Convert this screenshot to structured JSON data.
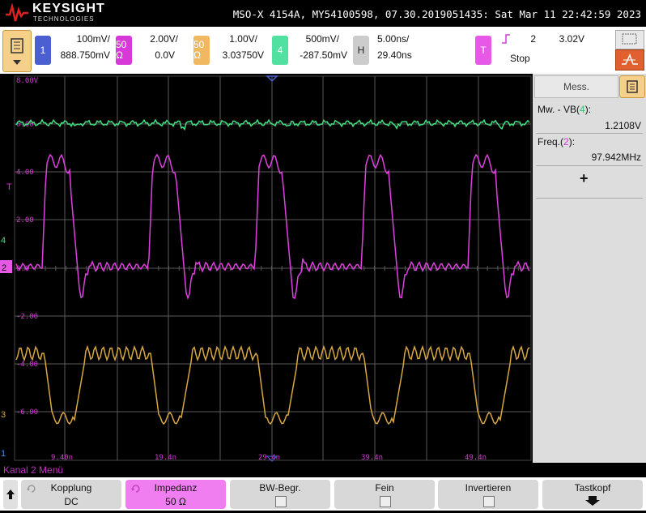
{
  "header": {
    "brand": "KEYSIGHT",
    "brand_sub": "TECHNOLOGIES",
    "info": "MSO-X 4154A, MY54100598, 07.30.2019051435: Sat Mar 11 22:42:59 2023"
  },
  "channels": [
    {
      "id": "1",
      "color": "#4a5fd0",
      "scale": "100mV/",
      "offset": "888.750mV"
    },
    {
      "id": "50 Ω",
      "color": "#d838d8",
      "scale": "2.00V/",
      "offset": "0.0V"
    },
    {
      "id": "50 Ω",
      "color": "#e0a040",
      "scale": "1.00V/",
      "offset": "3.03750V"
    },
    {
      "id": "4",
      "color": "#40d890",
      "scale": "500mV/",
      "offset": "-287.50mV"
    }
  ],
  "horizontal": {
    "badge": "H",
    "scale": "5.00ns/",
    "delay": "29.40ns"
  },
  "trigger": {
    "badge": "T",
    "source": "2",
    "level": "3.02V",
    "state": "Stop"
  },
  "grid": {
    "y_labels": [
      "8.00V",
      "6.00",
      "4.00",
      "2.00",
      "0.0",
      "-2.00",
      "-4.00",
      "-6.00"
    ],
    "x_labels": [
      "9.40n",
      "19.4n",
      "29.4n",
      "39.4n",
      "49.4n"
    ],
    "markers": {
      "ch4": "4",
      "ch2": "2",
      "ch3": "3",
      "ch1": "1",
      "trig": "T"
    }
  },
  "measurements": {
    "tab": "Mess.",
    "items": [
      {
        "label_pre": "Mw. - VB(",
        "label_ch": "4",
        "label_post": "):",
        "ch_color": "#30c070",
        "value": "1.2108V"
      },
      {
        "label_pre": "Freq.(",
        "label_ch": "2",
        "label_post": "):",
        "ch_color": "#d838d8",
        "value": "97.942MHz"
      }
    ],
    "add": "+"
  },
  "menu_title": "Kanal 2 Menü",
  "softkeys": [
    {
      "l1": "Kopplung",
      "l2": "DC"
    },
    {
      "l1": "Impedanz",
      "l2": "50 Ω"
    },
    {
      "l1": "BW-Begr.",
      "l2": ""
    },
    {
      "l1": "Fein",
      "l2": ""
    },
    {
      "l1": "Invertieren",
      "l2": ""
    },
    {
      "l1": "Tastkopf",
      "l2": ""
    }
  ],
  "colors": {
    "ch2": "#e040e0",
    "ch3": "#d8a840",
    "ch4": "#40e080",
    "ch1": "#4a5fd0",
    "grid": "#5a5a5a"
  }
}
